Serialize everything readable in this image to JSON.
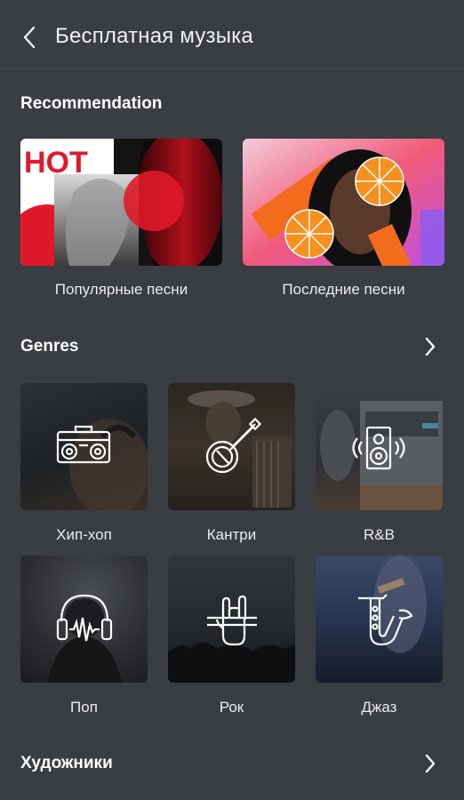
{
  "header": {
    "title": "Бесплатная музыка",
    "back_icon": "chevron-left-icon"
  },
  "recommendation": {
    "title": "Recommendation",
    "cards": [
      {
        "label": "Популярные песни",
        "art_text": "HOT"
      },
      {
        "label": "Последние песни"
      }
    ]
  },
  "genres": {
    "title": "Genres",
    "more_icon": "chevron-right-icon",
    "items": [
      {
        "label": "Хип-хоп",
        "icon": "boombox-icon"
      },
      {
        "label": "Кантри",
        "icon": "banjo-icon"
      },
      {
        "label": "R&B",
        "icon": "speaker-icon"
      },
      {
        "label": "Поп",
        "icon": "headphones-icon"
      },
      {
        "label": "Рок",
        "icon": "rock-hand-icon"
      },
      {
        "label": "Джаз",
        "icon": "saxophone-icon"
      }
    ]
  },
  "artists": {
    "title": "Художники",
    "more_icon": "chevron-right-icon"
  },
  "colors": {
    "background": "#3a3d41",
    "text": "#ffffff",
    "accent_red": "#e0192a",
    "accent_orange": "#f36b1c"
  }
}
